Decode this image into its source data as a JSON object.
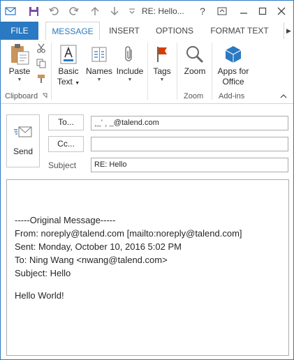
{
  "window": {
    "title": "RE: Hello...",
    "controls": [
      "?",
      "restore",
      "minimize",
      "maximize",
      "close"
    ]
  },
  "tabs": [
    "FILE",
    "MESSAGE",
    "INSERT",
    "OPTIONS",
    "FORMAT TEXT"
  ],
  "ribbon": {
    "groups": [
      {
        "name": "Clipboard",
        "buttons": [
          {
            "label": "Paste",
            "icon": "paste-icon"
          }
        ]
      },
      {
        "name": "",
        "buttons": [
          {
            "label": "Basic Text",
            "icon": "basic-text-icon"
          },
          {
            "label": "Names",
            "icon": "names-icon"
          },
          {
            "label": "Include",
            "icon": "include-icon"
          },
          {
            "label": "Tags",
            "icon": "flag-icon"
          }
        ]
      },
      {
        "name": "Zoom",
        "buttons": [
          {
            "label": "Zoom",
            "icon": "zoom-icon"
          }
        ]
      },
      {
        "name": "Add-ins",
        "buttons": [
          {
            "label": "Apps for Office",
            "icon": "apps-for-office-icon"
          }
        ]
      }
    ],
    "basic_text_l1": "Basic",
    "basic_text_l2": "Text",
    "apps_l1": "Apps for",
    "apps_l2": "Office"
  },
  "compose": {
    "send_label": "Send",
    "to_label": "To...",
    "cc_label": "Cc...",
    "subject_label": "Subject",
    "to_value": "@talend.com",
    "to_value_prefix": "¸_' ¸ _",
    "cc_value": "",
    "subject_value": "RE: Hello"
  },
  "body": {
    "lines": [
      "-----Original Message-----",
      "From: noreply@talend.com [mailto:noreply@talend.com]",
      "Sent: Monday, October 10, 2016 5:02 PM",
      "To: Ning Wang <nwang@talend.com>",
      "Subject: Hello",
      "",
      "Hello World!"
    ]
  },
  "colors": {
    "accent": "#2b79c2",
    "border": "#d4d4d4"
  }
}
